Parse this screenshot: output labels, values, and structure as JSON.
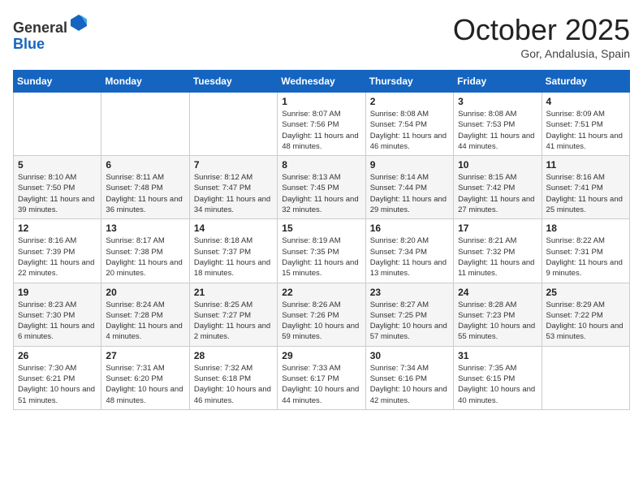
{
  "header": {
    "logo_general": "General",
    "logo_blue": "Blue",
    "month": "October 2025",
    "location": "Gor, Andalusia, Spain"
  },
  "weekdays": [
    "Sunday",
    "Monday",
    "Tuesday",
    "Wednesday",
    "Thursday",
    "Friday",
    "Saturday"
  ],
  "weeks": [
    [
      {
        "day": "",
        "info": ""
      },
      {
        "day": "",
        "info": ""
      },
      {
        "day": "",
        "info": ""
      },
      {
        "day": "1",
        "info": "Sunrise: 8:07 AM\nSunset: 7:56 PM\nDaylight: 11 hours and 48 minutes."
      },
      {
        "day": "2",
        "info": "Sunrise: 8:08 AM\nSunset: 7:54 PM\nDaylight: 11 hours and 46 minutes."
      },
      {
        "day": "3",
        "info": "Sunrise: 8:08 AM\nSunset: 7:53 PM\nDaylight: 11 hours and 44 minutes."
      },
      {
        "day": "4",
        "info": "Sunrise: 8:09 AM\nSunset: 7:51 PM\nDaylight: 11 hours and 41 minutes."
      }
    ],
    [
      {
        "day": "5",
        "info": "Sunrise: 8:10 AM\nSunset: 7:50 PM\nDaylight: 11 hours and 39 minutes."
      },
      {
        "day": "6",
        "info": "Sunrise: 8:11 AM\nSunset: 7:48 PM\nDaylight: 11 hours and 36 minutes."
      },
      {
        "day": "7",
        "info": "Sunrise: 8:12 AM\nSunset: 7:47 PM\nDaylight: 11 hours and 34 minutes."
      },
      {
        "day": "8",
        "info": "Sunrise: 8:13 AM\nSunset: 7:45 PM\nDaylight: 11 hours and 32 minutes."
      },
      {
        "day": "9",
        "info": "Sunrise: 8:14 AM\nSunset: 7:44 PM\nDaylight: 11 hours and 29 minutes."
      },
      {
        "day": "10",
        "info": "Sunrise: 8:15 AM\nSunset: 7:42 PM\nDaylight: 11 hours and 27 minutes."
      },
      {
        "day": "11",
        "info": "Sunrise: 8:16 AM\nSunset: 7:41 PM\nDaylight: 11 hours and 25 minutes."
      }
    ],
    [
      {
        "day": "12",
        "info": "Sunrise: 8:16 AM\nSunset: 7:39 PM\nDaylight: 11 hours and 22 minutes."
      },
      {
        "day": "13",
        "info": "Sunrise: 8:17 AM\nSunset: 7:38 PM\nDaylight: 11 hours and 20 minutes."
      },
      {
        "day": "14",
        "info": "Sunrise: 8:18 AM\nSunset: 7:37 PM\nDaylight: 11 hours and 18 minutes."
      },
      {
        "day": "15",
        "info": "Sunrise: 8:19 AM\nSunset: 7:35 PM\nDaylight: 11 hours and 15 minutes."
      },
      {
        "day": "16",
        "info": "Sunrise: 8:20 AM\nSunset: 7:34 PM\nDaylight: 11 hours and 13 minutes."
      },
      {
        "day": "17",
        "info": "Sunrise: 8:21 AM\nSunset: 7:32 PM\nDaylight: 11 hours and 11 minutes."
      },
      {
        "day": "18",
        "info": "Sunrise: 8:22 AM\nSunset: 7:31 PM\nDaylight: 11 hours and 9 minutes."
      }
    ],
    [
      {
        "day": "19",
        "info": "Sunrise: 8:23 AM\nSunset: 7:30 PM\nDaylight: 11 hours and 6 minutes."
      },
      {
        "day": "20",
        "info": "Sunrise: 8:24 AM\nSunset: 7:28 PM\nDaylight: 11 hours and 4 minutes."
      },
      {
        "day": "21",
        "info": "Sunrise: 8:25 AM\nSunset: 7:27 PM\nDaylight: 11 hours and 2 minutes."
      },
      {
        "day": "22",
        "info": "Sunrise: 8:26 AM\nSunset: 7:26 PM\nDaylight: 10 hours and 59 minutes."
      },
      {
        "day": "23",
        "info": "Sunrise: 8:27 AM\nSunset: 7:25 PM\nDaylight: 10 hours and 57 minutes."
      },
      {
        "day": "24",
        "info": "Sunrise: 8:28 AM\nSunset: 7:23 PM\nDaylight: 10 hours and 55 minutes."
      },
      {
        "day": "25",
        "info": "Sunrise: 8:29 AM\nSunset: 7:22 PM\nDaylight: 10 hours and 53 minutes."
      }
    ],
    [
      {
        "day": "26",
        "info": "Sunrise: 7:30 AM\nSunset: 6:21 PM\nDaylight: 10 hours and 51 minutes."
      },
      {
        "day": "27",
        "info": "Sunrise: 7:31 AM\nSunset: 6:20 PM\nDaylight: 10 hours and 48 minutes."
      },
      {
        "day": "28",
        "info": "Sunrise: 7:32 AM\nSunset: 6:18 PM\nDaylight: 10 hours and 46 minutes."
      },
      {
        "day": "29",
        "info": "Sunrise: 7:33 AM\nSunset: 6:17 PM\nDaylight: 10 hours and 44 minutes."
      },
      {
        "day": "30",
        "info": "Sunrise: 7:34 AM\nSunset: 6:16 PM\nDaylight: 10 hours and 42 minutes."
      },
      {
        "day": "31",
        "info": "Sunrise: 7:35 AM\nSunset: 6:15 PM\nDaylight: 10 hours and 40 minutes."
      },
      {
        "day": "",
        "info": ""
      }
    ]
  ]
}
